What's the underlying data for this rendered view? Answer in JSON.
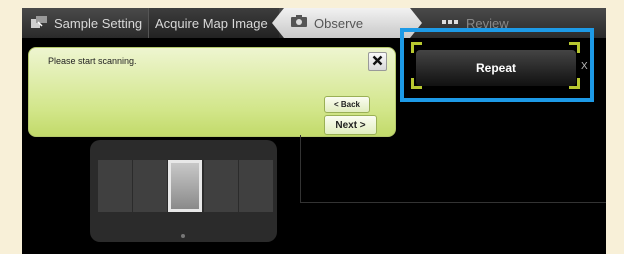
{
  "tabs": {
    "sample_setting": "Sample Setting",
    "acquire_map_image": "Acquire Map Image",
    "observe": "Observe",
    "review": "Review"
  },
  "dialog": {
    "message": "Please start scanning.",
    "back_label": "< Back",
    "next_label": "Next >"
  },
  "action": {
    "repeat_label": "Repeat",
    "x_label": "X"
  },
  "thumbnails": {
    "count": 5,
    "selected_index": 2
  },
  "colors": {
    "highlight": "#1d9ae6",
    "dialog_green": "#d2e68a",
    "bracket": "#b8c830"
  },
  "icons": [
    "sample-setting-icon",
    "camera-icon",
    "grid-icon",
    "close-icon"
  ]
}
